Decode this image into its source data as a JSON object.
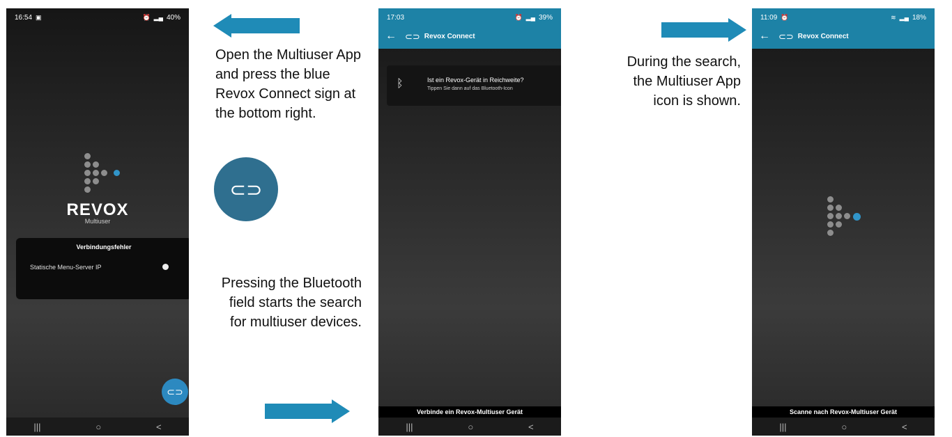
{
  "phone1": {
    "status": {
      "time": "16:54",
      "right": "40%"
    },
    "brand": "REVOX",
    "brand_sub": "Multiuser",
    "dialog": {
      "title": "Verbindungsfehler",
      "row_label": "Statische Menu-Server IP"
    },
    "nav": {
      "recent": "|||",
      "home": "○",
      "back": "<"
    }
  },
  "phone2": {
    "status": {
      "time": "17:03",
      "right": "39%"
    },
    "appbar_title": "Revox Connect",
    "bt_card": {
      "line1": "Ist ein Revox-Gerät in Reichweite?",
      "line2": "Tippen Sie dann auf das Bluetooth-Icon"
    },
    "bottom_label": "Verbinde ein Revox-Multiuser Gerät",
    "nav": {
      "recent": "|||",
      "home": "○",
      "back": "<"
    }
  },
  "phone3": {
    "status": {
      "time": "11:09",
      "right": "18%"
    },
    "appbar_title": "Revox Connect",
    "bottom_label": "Scanne nach Revox-Multiuser Gerät",
    "nav": {
      "recent": "|||",
      "home": "○",
      "back": "<"
    }
  },
  "notes": {
    "open_app": "Open the Multiuser App and press the blue Revox Connect sign at the bottom right.",
    "pressing_bt": "Pressing the Bluetooth field starts the search for multiuser devices.",
    "during_search": "During the search, the Multiuser App icon is shown."
  },
  "icons": {
    "link": "link-icon",
    "back": "back-arrow-icon",
    "bluetooth": "bluetooth-icon"
  },
  "colors": {
    "accent": "#1f8bb7",
    "appbar": "#1d82a6",
    "fab": "#2c89c0"
  }
}
